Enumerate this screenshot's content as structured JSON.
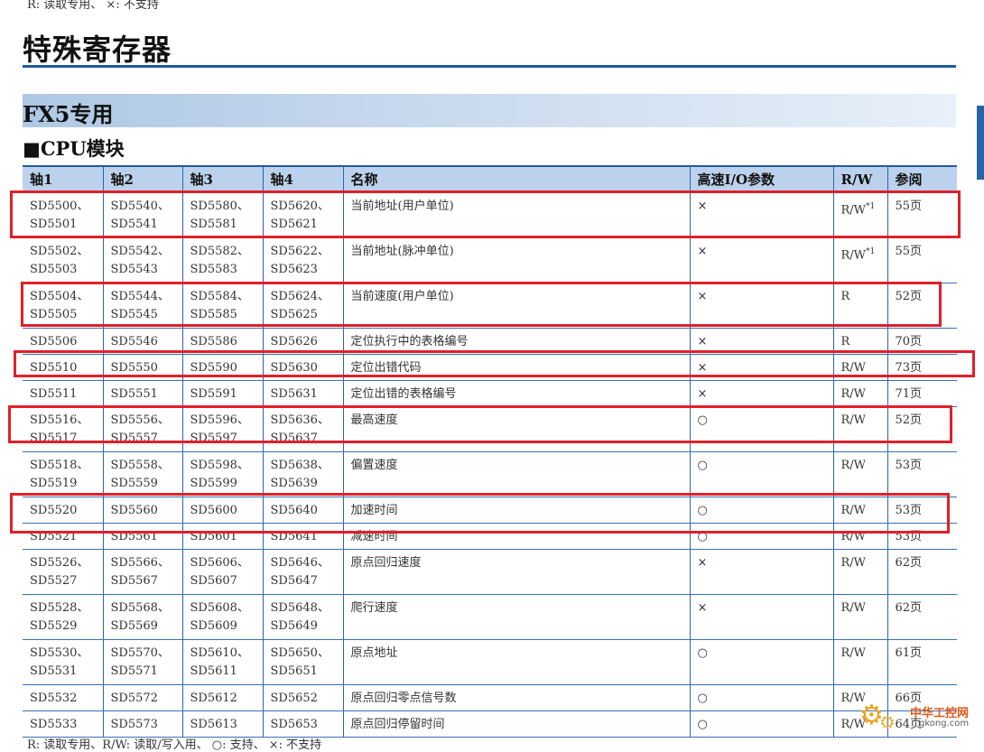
{
  "top_note": "R: 读取专用、 ×: 不支持",
  "page_title": "特殊寄存器",
  "section_title": "FX5专用",
  "subsection_title": "■CPU模块",
  "table": {
    "headers": [
      "轴1",
      "轴2",
      "轴3",
      "轴4",
      "名称",
      "高速I/O参数",
      "R/W",
      "参阅"
    ],
    "rows": [
      {
        "axis1": [
          "SD5500、",
          "SD5501"
        ],
        "axis2": [
          "SD5540、",
          "SD5541"
        ],
        "axis3": [
          "SD5580、",
          "SD5581"
        ],
        "axis4": [
          "SD5620、",
          "SD5621"
        ],
        "name": "当前地址(用户单位)",
        "hsio": "×",
        "rw": "R/W",
        "rw_note": "*1",
        "ref": "55页"
      },
      {
        "axis1": [
          "SD5502、",
          "SD5503"
        ],
        "axis2": [
          "SD5542、",
          "SD5543"
        ],
        "axis3": [
          "SD5582、",
          "SD5583"
        ],
        "axis4": [
          "SD5622、",
          "SD5623"
        ],
        "name": "当前地址(脉冲单位)",
        "hsio": "×",
        "rw": "R/W",
        "rw_note": "*1",
        "ref": "55页"
      },
      {
        "axis1": [
          "SD5504、",
          "SD5505"
        ],
        "axis2": [
          "SD5544、",
          "SD5545"
        ],
        "axis3": [
          "SD5584、",
          "SD5585"
        ],
        "axis4": [
          "SD5624、",
          "SD5625"
        ],
        "name": "当前速度(用户单位)",
        "hsio": "×",
        "rw": "R",
        "rw_note": "",
        "ref": "52页"
      },
      {
        "axis1": [
          "SD5506"
        ],
        "axis2": [
          "SD5546"
        ],
        "axis3": [
          "SD5586"
        ],
        "axis4": [
          "SD5626"
        ],
        "name": "定位执行中的表格编号",
        "hsio": "×",
        "rw": "R",
        "rw_note": "",
        "ref": "70页"
      },
      {
        "axis1": [
          "SD5510"
        ],
        "axis2": [
          "SD5550"
        ],
        "axis3": [
          "SD5590"
        ],
        "axis4": [
          "SD5630"
        ],
        "name": "定位出错代码",
        "hsio": "×",
        "rw": "R/W",
        "rw_note": "",
        "ref": "73页"
      },
      {
        "axis1": [
          "SD5511"
        ],
        "axis2": [
          "SD5551"
        ],
        "axis3": [
          "SD5591"
        ],
        "axis4": [
          "SD5631"
        ],
        "name": "定位出错的表格编号",
        "hsio": "×",
        "rw": "R/W",
        "rw_note": "",
        "ref": "71页"
      },
      {
        "axis1": [
          "SD5516、",
          "SD5517"
        ],
        "axis2": [
          "SD5556、",
          "SD5557"
        ],
        "axis3": [
          "SD5596、",
          "SD5597"
        ],
        "axis4": [
          "SD5636、",
          "SD5637"
        ],
        "name": "最高速度",
        "hsio": "○",
        "rw": "R/W",
        "rw_note": "",
        "ref": "52页"
      },
      {
        "axis1": [
          "SD5518、",
          "SD5519"
        ],
        "axis2": [
          "SD5558、",
          "SD5559"
        ],
        "axis3": [
          "SD5598、",
          "SD5599"
        ],
        "axis4": [
          "SD5638、",
          "SD5639"
        ],
        "name": "偏置速度",
        "hsio": "○",
        "rw": "R/W",
        "rw_note": "",
        "ref": "53页"
      },
      {
        "axis1": [
          "SD5520"
        ],
        "axis2": [
          "SD5560"
        ],
        "axis3": [
          "SD5600"
        ],
        "axis4": [
          "SD5640"
        ],
        "name": "加速时间",
        "hsio": "○",
        "rw": "R/W",
        "rw_note": "",
        "ref": "53页"
      },
      {
        "axis1": [
          "SD5521"
        ],
        "axis2": [
          "SD5561"
        ],
        "axis3": [
          "SD5601"
        ],
        "axis4": [
          "SD5641"
        ],
        "name": "减速时间",
        "hsio": "○",
        "rw": "R/W",
        "rw_note": "",
        "ref": "53页"
      },
      {
        "axis1": [
          "SD5526、",
          "SD5527"
        ],
        "axis2": [
          "SD5566、",
          "SD5567"
        ],
        "axis3": [
          "SD5606、",
          "SD5607"
        ],
        "axis4": [
          "SD5646、",
          "SD5647"
        ],
        "name": "原点回归速度",
        "hsio": "×",
        "rw": "R/W",
        "rw_note": "",
        "ref": "62页"
      },
      {
        "axis1": [
          "SD5528、",
          "SD5529"
        ],
        "axis2": [
          "SD5568、",
          "SD5569"
        ],
        "axis3": [
          "SD5608、",
          "SD5609"
        ],
        "axis4": [
          "SD5648、",
          "SD5649"
        ],
        "name": "爬行速度",
        "hsio": "×",
        "rw": "R/W",
        "rw_note": "",
        "ref": "62页"
      },
      {
        "axis1": [
          "SD5530、",
          "SD5531"
        ],
        "axis2": [
          "SD5570、",
          "SD5571"
        ],
        "axis3": [
          "SD5610、",
          "SD5611"
        ],
        "axis4": [
          "SD5650、",
          "SD5651"
        ],
        "name": "原点地址",
        "hsio": "○",
        "rw": "R/W",
        "rw_note": "",
        "ref": "61页"
      },
      {
        "axis1": [
          "SD5532"
        ],
        "axis2": [
          "SD5572"
        ],
        "axis3": [
          "SD5612"
        ],
        "axis4": [
          "SD5652"
        ],
        "name": "原点回归零点信号数",
        "hsio": "○",
        "rw": "R/W",
        "rw_note": "",
        "ref": "66页"
      },
      {
        "axis1": [
          "SD5533"
        ],
        "axis2": [
          "SD5573"
        ],
        "axis3": [
          "SD5613"
        ],
        "axis4": [
          "SD5653"
        ],
        "name": "原点回归停留时间",
        "hsio": "○",
        "rw": "R/W",
        "rw_note": "",
        "ref": "64页"
      }
    ]
  },
  "highlight_color": "#e0202a",
  "header_color": "#bcd2ec",
  "rule_color": "#1f5c9e",
  "bottom_note": "R: 读取专用、R/W: 读取/写入用、 ○: 支持、 ×: 不支持",
  "watermark": {
    "brand": "中华工控网",
    "url": "gkong.com",
    "icon": "gear-icon"
  }
}
